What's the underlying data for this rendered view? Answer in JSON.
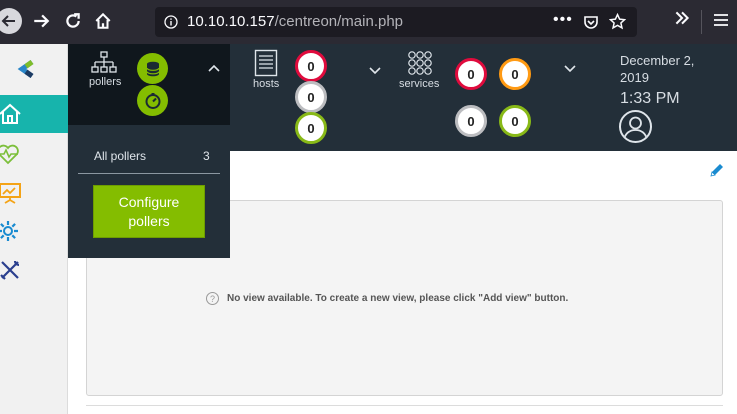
{
  "browser": {
    "url_host": "10.10.10.157",
    "url_path": "/centreon/main.php"
  },
  "sidebar": {
    "items": [
      {
        "name": "home",
        "active": true
      },
      {
        "name": "monitoring"
      },
      {
        "name": "reporting"
      },
      {
        "name": "configuration"
      },
      {
        "name": "administration"
      }
    ]
  },
  "header": {
    "pollers_label": "pollers",
    "hosts_label": "hosts",
    "services_label": "services",
    "hosts_counts": {
      "down": "0",
      "unreachable": "0",
      "up": "0"
    },
    "services_counts": {
      "critical": "0",
      "warning": "0",
      "unknown": "0",
      "ok": "0"
    },
    "date_line1": "December 2,",
    "date_line2": "2019",
    "time": "1:33 PM",
    "colors": {
      "critical": "#e00b3d",
      "warning": "#ff9a13",
      "ok": "#88b917",
      "unknown": "#bcbdc0"
    }
  },
  "pollers_menu": {
    "all_pollers_label": "All pollers",
    "all_pollers_count": "3",
    "configure_label_line1": "Configure",
    "configure_label_line2": "pollers"
  },
  "main": {
    "empty_message": "No view available. To create a new view, please click \"Add view\" button."
  }
}
